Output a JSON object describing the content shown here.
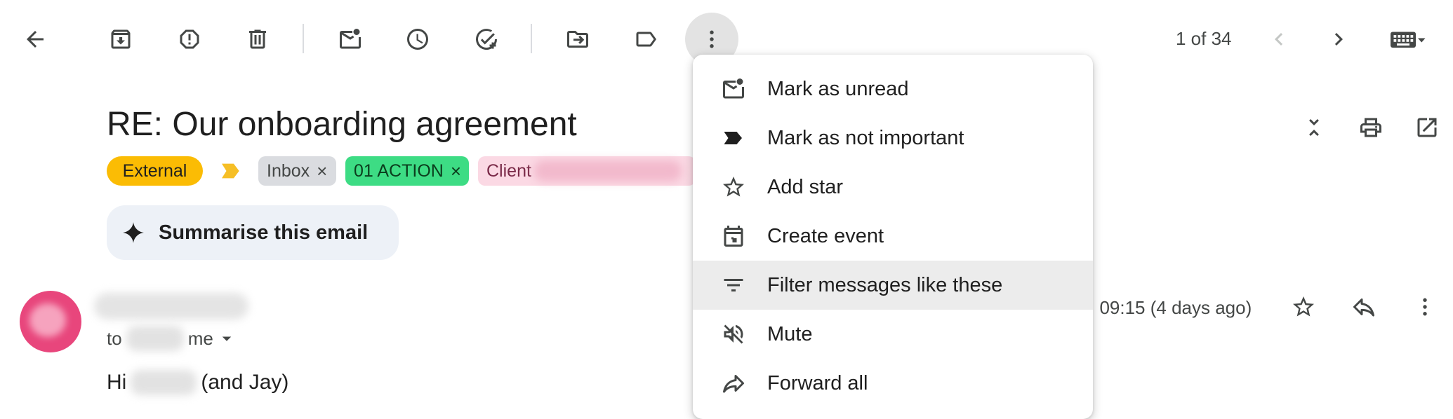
{
  "toolbar": {
    "pager_text": "1 of 34"
  },
  "message": {
    "subject": "RE: Our onboarding agreement",
    "labels": {
      "external": "External",
      "inbox": "Inbox",
      "action": "01 ACTION",
      "client": "Client",
      "remove_glyph": "×"
    },
    "summarise_label": "Summarise this email",
    "to_prefix": "to",
    "to_me": "me",
    "timestamp": ", 09:15 (4 days ago)",
    "greeting_prefix": "Hi",
    "greeting_suffix": "(and Jay)"
  },
  "menu": {
    "items": [
      {
        "label": "Mark as unread",
        "icon": "mark-unread-icon"
      },
      {
        "label": "Mark as not important",
        "icon": "important-marker-icon"
      },
      {
        "label": "Add star",
        "icon": "star-outline-icon"
      },
      {
        "label": "Create event",
        "icon": "calendar-event-icon"
      },
      {
        "label": "Filter messages like these",
        "icon": "filter-icon"
      },
      {
        "label": "Mute",
        "icon": "mute-icon"
      },
      {
        "label": "Forward all",
        "icon": "forward-icon"
      }
    ]
  },
  "colors": {
    "external_chip": "#fbbc04",
    "action_chip": "#3ddc84",
    "client_chip": "#fbd9e4",
    "avatar": "#e8467c"
  }
}
